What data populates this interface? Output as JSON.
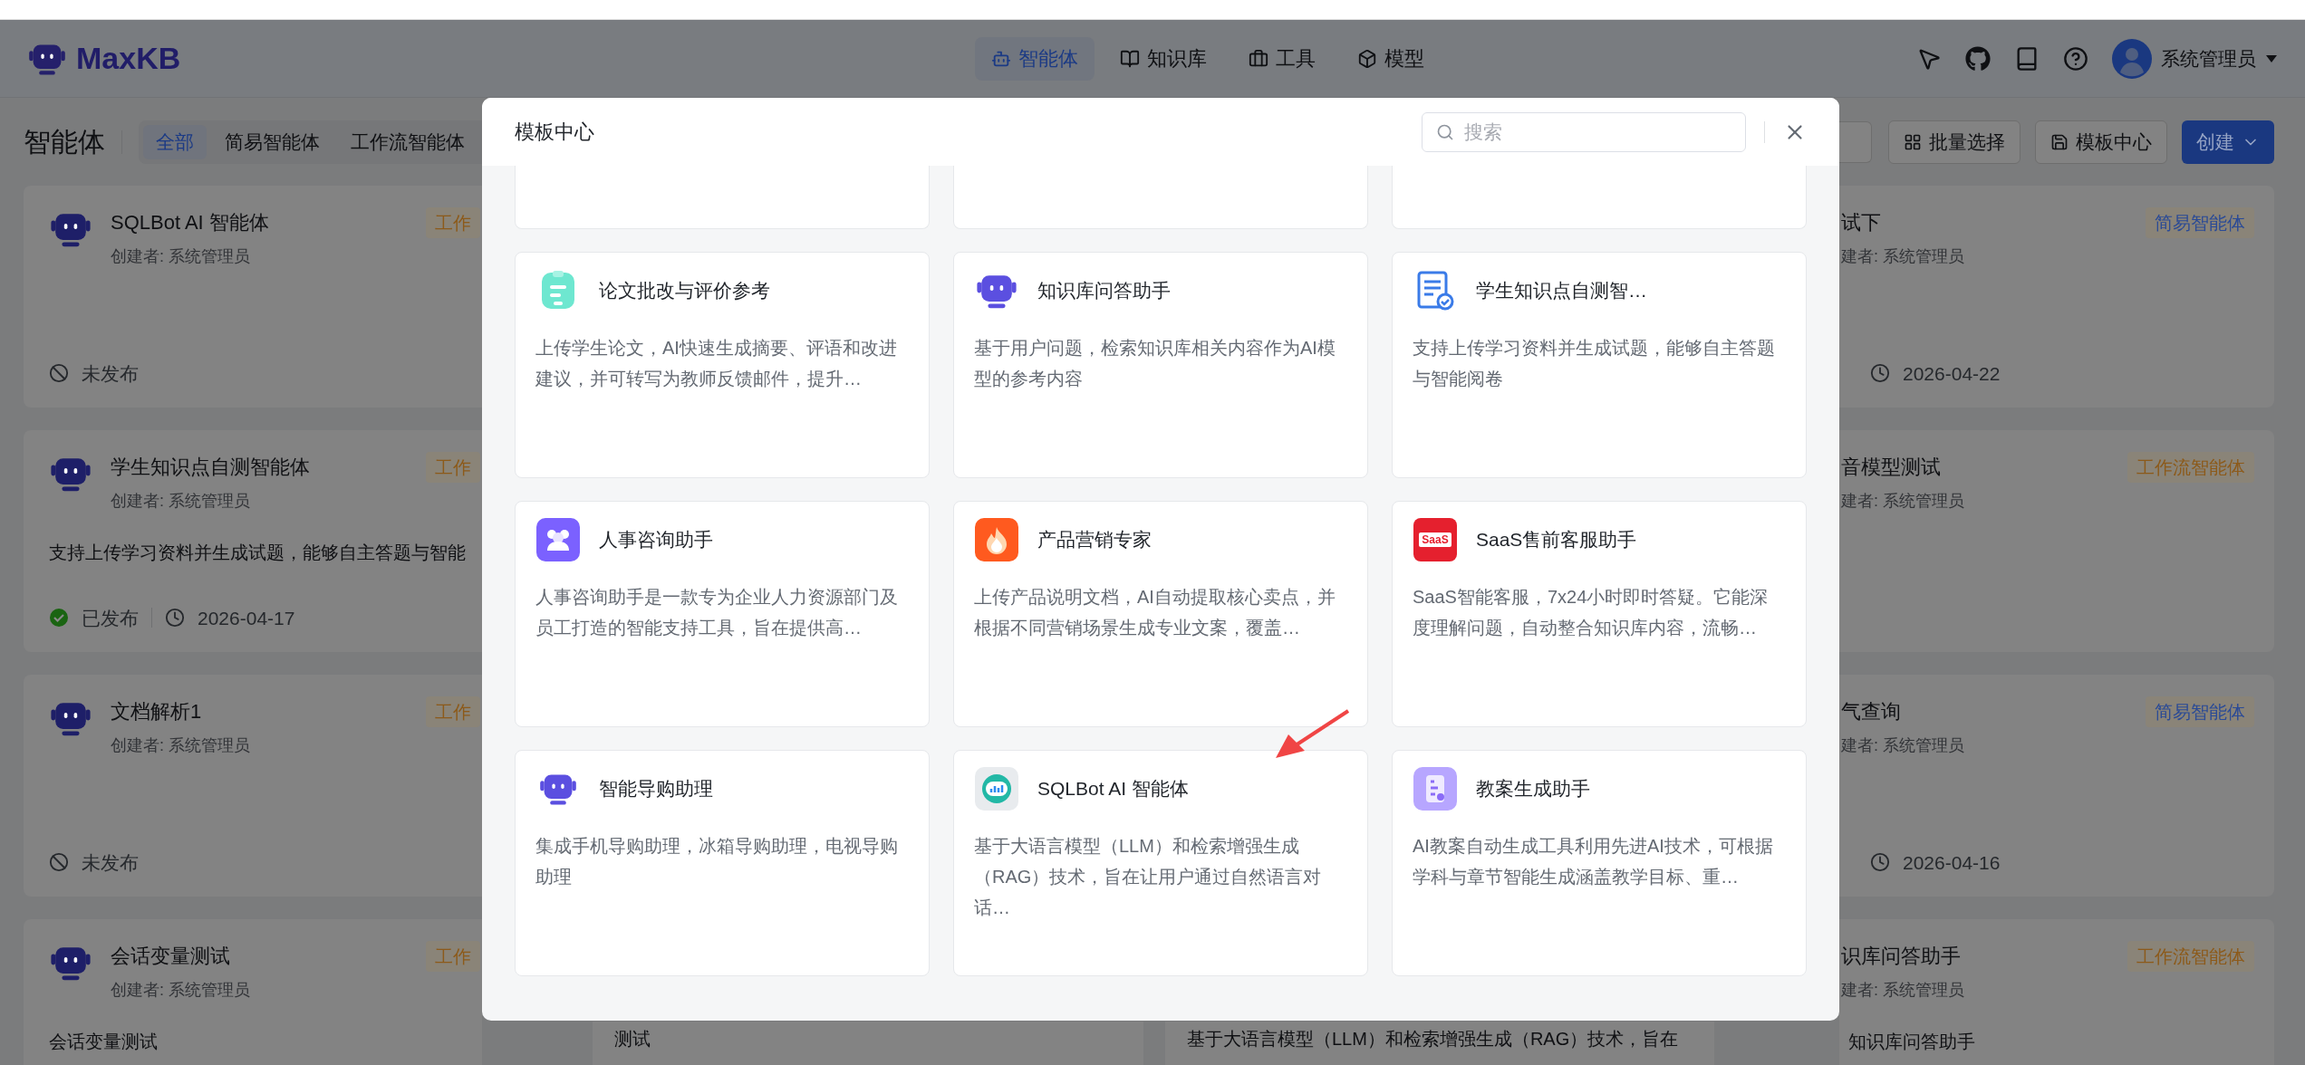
{
  "header": {
    "logo_text": "MaxKB",
    "nav": [
      {
        "label": "智能体",
        "selected": true
      },
      {
        "label": "知识库",
        "selected": false
      },
      {
        "label": "工具",
        "selected": false
      },
      {
        "label": "模型",
        "selected": false
      }
    ],
    "user": {
      "name": "系统管理员"
    }
  },
  "page": {
    "title": "智能体",
    "filters": [
      {
        "label": "全部",
        "selected": true
      },
      {
        "label": "简易智能体",
        "selected": false
      },
      {
        "label": "工作流智能体",
        "selected": false
      }
    ],
    "actions": [
      {
        "label": "批量选择",
        "kind": "select"
      },
      {
        "label": "模板中心",
        "kind": "template"
      },
      {
        "label": "创建",
        "kind": "primary"
      }
    ]
  },
  "agent_columns": [
    {
      "cards": [
        {
          "title": "SQLBot AI 智能体",
          "creator": "创建者: 系统管理员",
          "badge": {
            "label": "工作",
            "color": "#8c5a1a"
          },
          "status": {
            "label": "未发布",
            "published": false
          }
        },
        {
          "title": "学生知识点自测智能体",
          "creator": "创建者: 系统管理员",
          "badge": {
            "label": "工作",
            "color": "#8c5a1a"
          },
          "description": "支持上传学习资料并生成试题，能够自主答题与智能",
          "status": {
            "label": "已发布",
            "published": true
          },
          "date": "2026-04-17"
        },
        {
          "title": "文档解析1",
          "creator": "创建者: 系统管理员",
          "badge": {
            "label": "工作",
            "color": "#8c5a1a"
          },
          "status": {
            "label": "未发布",
            "published": false
          }
        },
        {
          "title": "会话变量测试",
          "creator": "创建者: 系统管理员",
          "badge": {
            "label": "工作",
            "color": "#8c5a1a"
          },
          "description": "会话变量测试"
        }
      ]
    },
    {
      "cards": [
        {
          "description": "测试"
        }
      ]
    },
    {
      "cards": [
        {
          "description": "基于大语言模型（LLM）和检索增强生成（RAG）技术，旨在"
        }
      ]
    },
    {
      "cards": [
        {
          "title": "试下",
          "creator": "建者: 系统管理员",
          "badge": {
            "label": "简易智能体",
            "color": "#2a4a96"
          },
          "date": "2026-04-22"
        },
        {
          "title": "音模型测试",
          "creator": "建者: 系统管理员",
          "badge": {
            "label": "工作流智能体",
            "color": "#8c5a1a"
          }
        },
        {
          "title": "气查询",
          "creator": "建者: 系统管理员",
          "badge": {
            "label": "简易智能体",
            "color": "#2a4a96"
          },
          "date": "2026-04-16"
        },
        {
          "title": "识库问答助手",
          "creator": "建者: 系统管理员",
          "badge": {
            "label": "工作流智能体",
            "color": "#8c5a1a"
          },
          "description": "知识库问答助手"
        }
      ]
    }
  ],
  "template_center": {
    "title": "模板中心",
    "search": {
      "placeholder": "搜索"
    },
    "templates": [
      {
        "title": "论文批改与评价参考",
        "description": "上传学生论文，AI快速生成摘要、评语和改进建议，并可转写为教师反馈邮件，提升…"
      },
      {
        "title": "知识库问答助手",
        "description": "基于用户问题，检索知识库相关内容作为AI模型的参考内容"
      },
      {
        "title": "学生知识点自测智…",
        "description": "支持上传学习资料并生成试题，能够自主答题与智能阅卷"
      },
      {
        "title": "人事咨询助手",
        "description": "人事咨询助手是一款专为企业人力资源部门及员工打造的智能支持工具，旨在提供高…"
      },
      {
        "title": "产品营销专家",
        "description": "上传产品说明文档，AI自动提取核心卖点，并根据不同营销场景生成专业文案，覆盖…"
      },
      {
        "title": "SaaS售前客服助手",
        "description": "SaaS智能客服，7x24小时即时答疑。它能深度理解问题，自动整合知识库内容，流畅…",
        "icon_label": "SaaS"
      },
      {
        "title": "智能导购助理",
        "description": "集成手机导购助理，冰箱导购助理，电视导购助理"
      },
      {
        "title": "SQLBot AI 智能体",
        "description": "基于大语言模型（LLM）和检索增强生成（RAG）技术，旨在让用户通过自然语言对话…"
      },
      {
        "title": "教案生成助手",
        "description": "AI教案自动生成工具利用先进AI技术，可根据学科与章节智能生成涵盖教学目标、重…"
      }
    ]
  }
}
